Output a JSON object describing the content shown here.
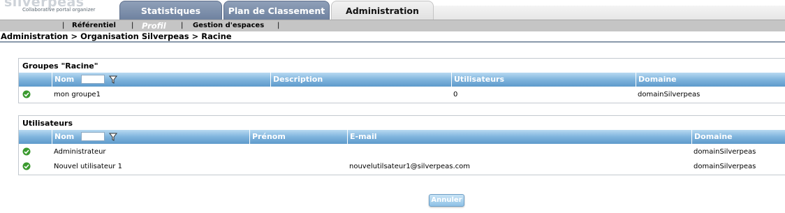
{
  "logo": {
    "word": "silverpeas",
    "tagline": "Collaborative portal organizer"
  },
  "tabs": [
    {
      "label": "Statistiques"
    },
    {
      "label": "Plan de Classement"
    },
    {
      "label": "Administration"
    }
  ],
  "subnav": {
    "items": [
      {
        "label": "Référentiel"
      },
      {
        "label": "Profil"
      },
      {
        "label": "Gestion d'espaces"
      }
    ],
    "separator": "|"
  },
  "breadcrumb": "Administration > Organisation Silverpeas > Racine",
  "groups": {
    "title": "Groupes \"Racine\"",
    "columns": [
      "Nom",
      "Description",
      "Utilisateurs",
      "Domaine"
    ],
    "rows": [
      {
        "name": "mon groupe1",
        "description": "",
        "users": "0",
        "domain": "domainSilverpeas",
        "status": "active"
      }
    ]
  },
  "users": {
    "title": "Utilisateurs",
    "columns": [
      "Nom",
      "Prénom",
      "E-mail",
      "Domaine"
    ],
    "rows": [
      {
        "name": "Administrateur",
        "firstname": "",
        "email": "",
        "domain": "domainSilverpeas",
        "status": "active"
      },
      {
        "name": "Nouvel utilisateur 1",
        "firstname": "",
        "email": "nouvelutilsateur1@silverpeas.com",
        "domain": "domainSilverpeas",
        "status": "active"
      }
    ]
  },
  "cancel_button": "Annuler",
  "colors": {
    "tab_inactive": "#7b8dab",
    "header_blue": "#7fb4dd",
    "status_green": "#3b9a2f"
  }
}
